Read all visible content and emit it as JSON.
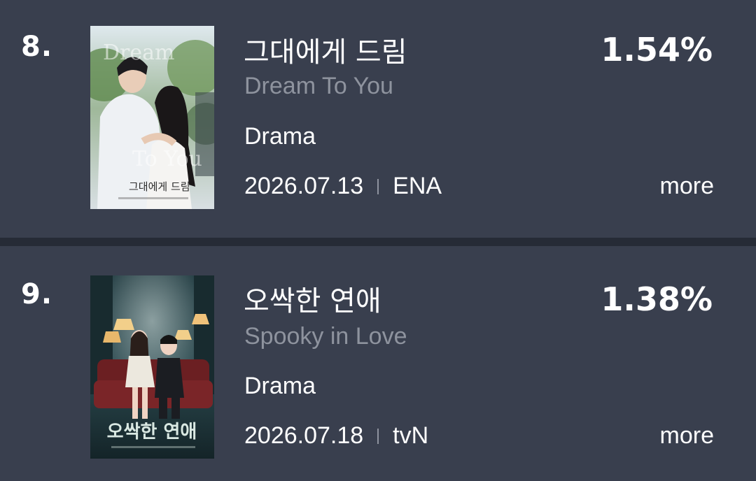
{
  "items": [
    {
      "rank": "8.",
      "title": "그대에게 드림",
      "subtitle": "Dream To You",
      "genre": "Drama",
      "date": "2026.07.13",
      "network": "ENA",
      "rating": "1.54%",
      "more_label": "more",
      "poster_text": "Dream To You"
    },
    {
      "rank": "9.",
      "title": "오싹한 연애",
      "subtitle": "Spooky in Love",
      "genre": "Drama",
      "date": "2026.07.18",
      "network": "tvN",
      "rating": "1.38%",
      "more_label": "more",
      "poster_text": "오싹한 연애"
    }
  ]
}
